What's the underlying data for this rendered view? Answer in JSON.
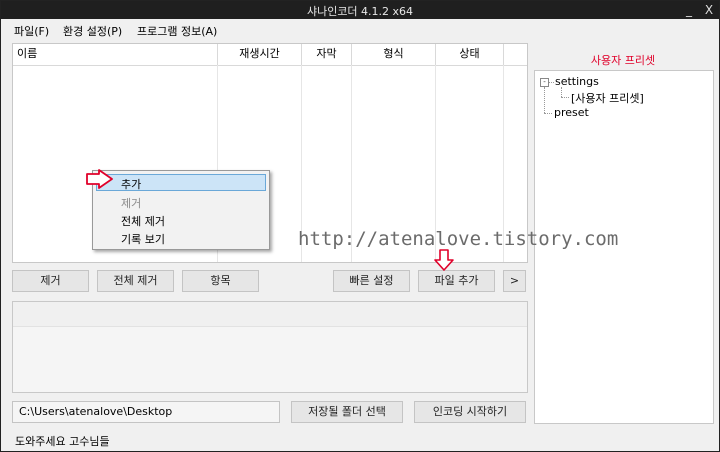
{
  "window": {
    "title": "샤나인코더 4.1.2 x64",
    "minimize": "_",
    "close": "X"
  },
  "menu": [
    "파일(F)",
    "환경 설정(P)",
    "프로그램 정보(A)"
  ],
  "columns": [
    "이름",
    "재생시간",
    "자막",
    "형식",
    "상태"
  ],
  "context_menu": [
    {
      "label": "추가",
      "selected": true,
      "disabled": false
    },
    {
      "label": "제거",
      "selected": false,
      "disabled": true
    },
    {
      "label": "전체 제거",
      "selected": false,
      "disabled": false
    },
    {
      "label": "기록 보기",
      "selected": false,
      "disabled": false
    }
  ],
  "buttons": {
    "remove": "제거",
    "remove_all": "전체 제거",
    "items": "항목",
    "quick_settings": "빠른 설정",
    "add_file": "파일 추가",
    "more": ">"
  },
  "output": {
    "path": "C:\\Users\\atenalove\\Desktop",
    "select_folder": "저장될 폴더 선택",
    "start_encoding": "인코딩 시작하기"
  },
  "status_text": "도와주세요 고수님들",
  "preset_panel": {
    "title": "사용자 프리셋",
    "tree": [
      {
        "label": "settings",
        "expander": "-"
      },
      {
        "label": "[사용자 프리셋]"
      },
      {
        "label": "preset"
      }
    ]
  },
  "watermark": "http://atenalove.tistory.com",
  "colors": {
    "accent_red": "#e0002a",
    "selection": "#cce4f7",
    "titlebar": "#1f1f1f"
  }
}
